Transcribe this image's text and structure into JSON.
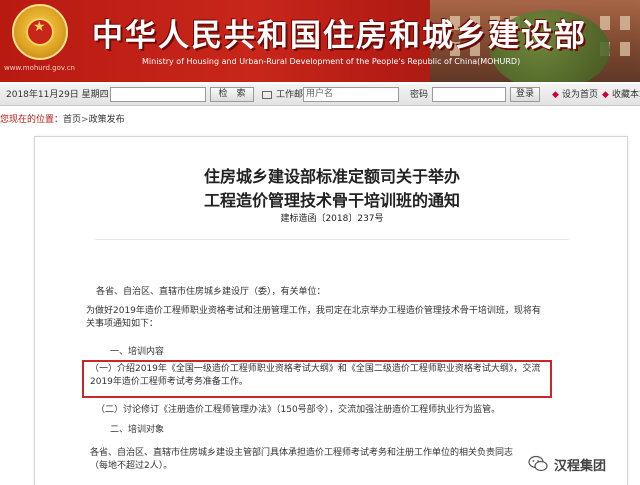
{
  "header": {
    "site_title": "中华人民共和国住房和城乡建设部",
    "site_subtitle": "Ministry of Housing and Urban-Rural Development of the People's Republic of China(MOHURD)",
    "emblem_url": "www.mohurd.gov.cn",
    "colors": {
      "banner": "#c8261a",
      "title_text": "#ffffff",
      "highlight_border": "#c8282a"
    }
  },
  "toolbar": {
    "date": "2018年11月29日 星期四",
    "search_button": "检　索",
    "mail_label": "工作邮箱：",
    "user_placeholder": "用户名",
    "password_label": "密码",
    "login_button": "登录",
    "home_label": "设为首页",
    "favorite_label": "收藏本站"
  },
  "breadcrumb": {
    "here_label": "您现在的位置：",
    "items": [
      "首页",
      "政策发布"
    ],
    "separator": ">"
  },
  "document": {
    "title_line1": "住房城乡建设部标准定额司关于举办",
    "title_line2": "工程造价管理技术骨干培训班的通知",
    "doc_number": "建标造函〔2018〕237号",
    "recipients": "各省、自治区、直辖市住房城乡建设厅（委），有关单位：",
    "intro": "为做好2019年造价工程师职业资格考试和注册管理工作，我司定在北京举办工程造价管理技术骨干培训班，现将有关事项通知如下：",
    "section1_heading": "一、培训内容",
    "item1": "（一）介绍2019年《全国一级造价工程师职业资格考试大纲》和《全国二级造价工程师职业资格考试大纲》，交流2019年造价工程师考试考务准备工作。",
    "item2": "（二）讨论修订《注册造价工程师管理办法》（150号部令），交流加强注册造价工程师执业行为监管。",
    "section2_heading": "二、培训对象",
    "section2_body": "各省、自治区、直辖市住房城乡建设主管部门具体承担造价工程师考试考务和注册工作单位的相关负责同志（每地不超过2人）。"
  },
  "watermark": {
    "text": "汉程集团",
    "icon": "wechat-icon"
  }
}
